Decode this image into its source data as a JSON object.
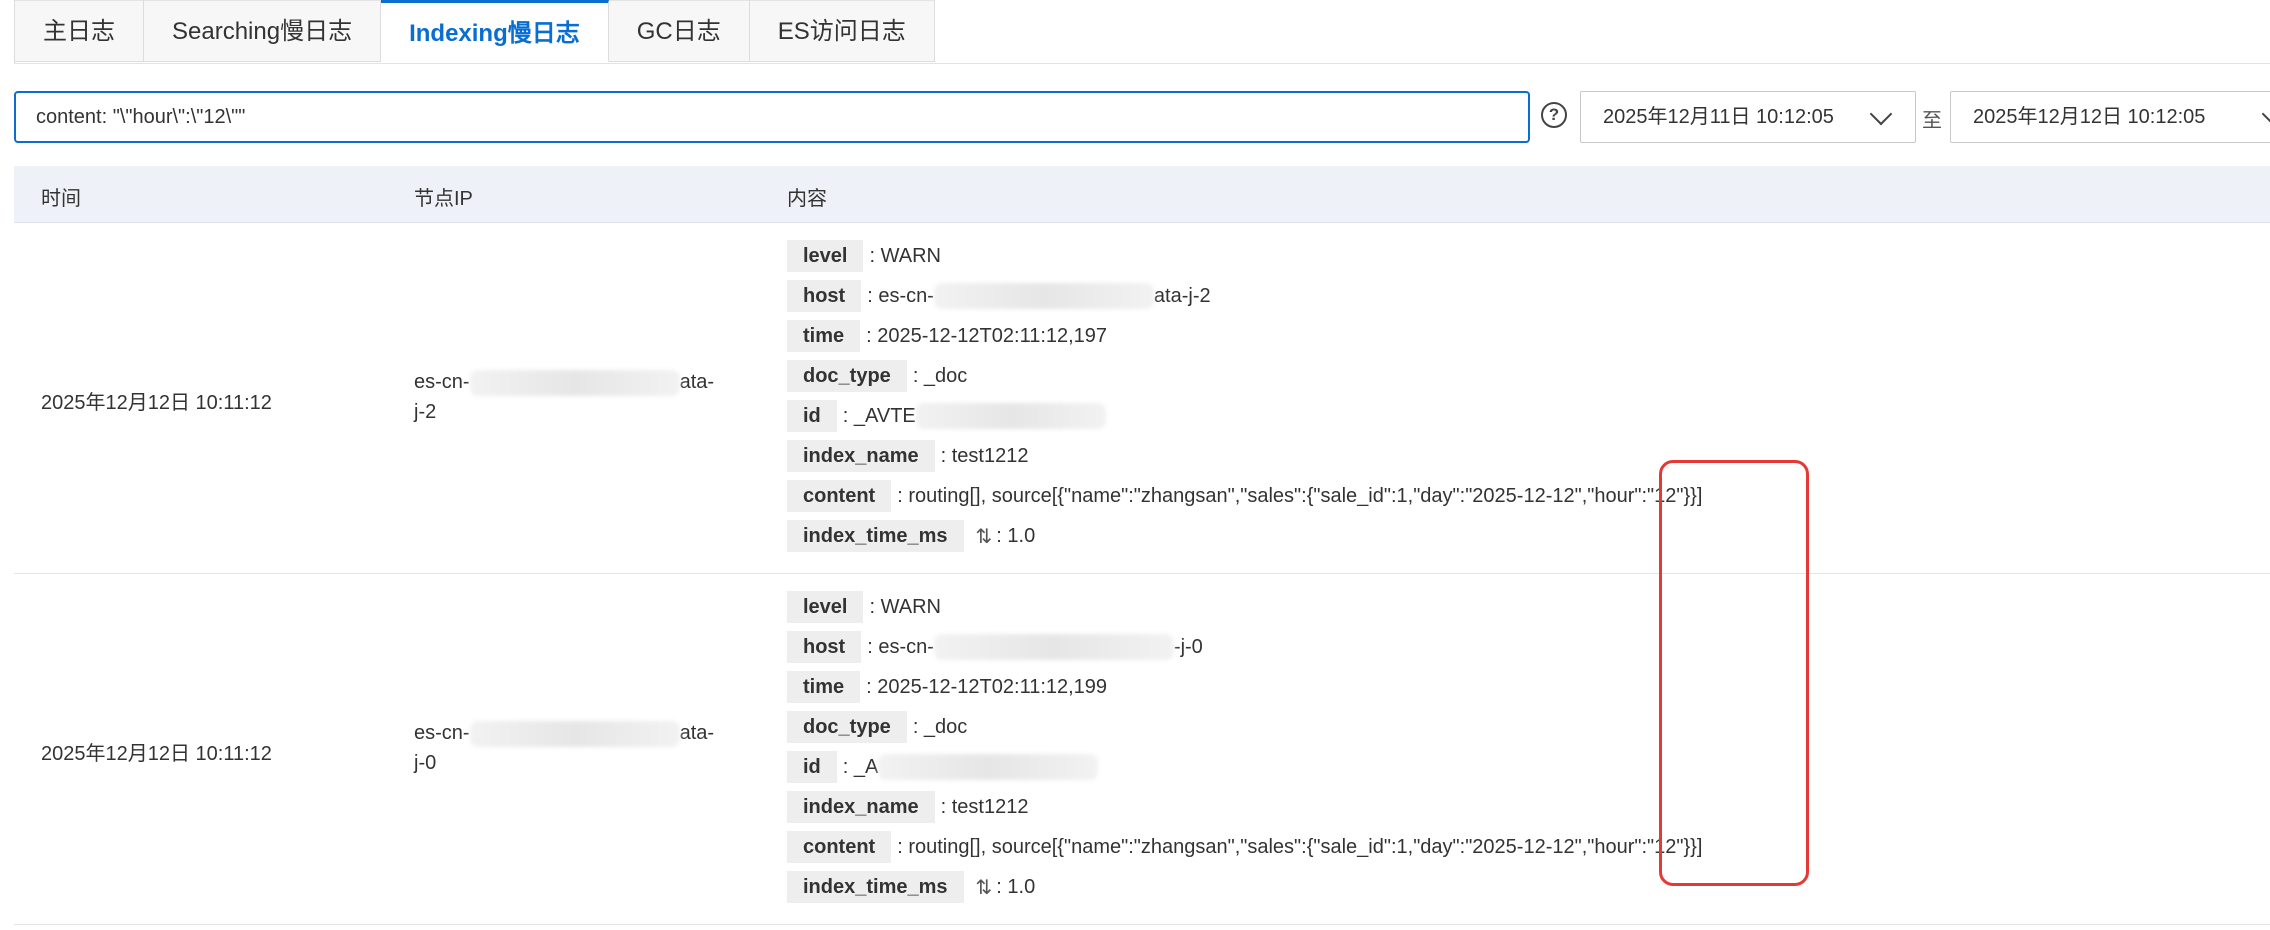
{
  "tabs": [
    {
      "label": "主日志",
      "active": false
    },
    {
      "label": "Searching慢日志",
      "active": false
    },
    {
      "label": "Indexing慢日志",
      "active": true
    },
    {
      "label": "GC日志",
      "active": false
    },
    {
      "label": "ES访问日志",
      "active": false
    }
  ],
  "search": {
    "value": "content: \"\\\"hour\\\":\\\"12\\\"\""
  },
  "help": {
    "symbol": "?"
  },
  "date_range": {
    "start": "2025年12月11日 10:12:05",
    "separator": "至",
    "end": "2025年12月12日 10:12:05"
  },
  "table": {
    "headers": {
      "time": "时间",
      "node_ip": "节点IP",
      "content": "内容"
    },
    "rows": [
      {
        "time": "2025年12月12日 10:11:12",
        "node_ip_prefix": "es-cn-",
        "node_ip_suffix": "ata-",
        "node_ip_line2": "j-2",
        "fields": {
          "level_key": "level",
          "level_val": ": WARN",
          "host_key": "host",
          "host_prefix": ": es-cn-",
          "host_suffix": "ata-j-2",
          "time_key": "time",
          "time_val": ": 2025-12-12T02:11:12,197",
          "doc_type_key": "doc_type",
          "doc_type_val": ": _doc",
          "id_key": "id",
          "id_val": ": _AVTE",
          "index_name_key": "index_name",
          "index_name_val": ": test1212",
          "content_key": "content",
          "content_val": ": routing[], source[{\"name\":\"zhangsan\",\"sales\":{\"sale_id\":1,\"day\":\"2025-12-12\",\"hour\":\"12\"}}]",
          "index_time_key": "index_time_ms",
          "index_time_val": ": 1.0"
        }
      },
      {
        "time": "2025年12月12日 10:11:12",
        "node_ip_prefix": "es-cn-",
        "node_ip_suffix": "ata-",
        "node_ip_line2": "j-0",
        "fields": {
          "level_key": "level",
          "level_val": ": WARN",
          "host_key": "host",
          "host_prefix": ": es-cn-",
          "host_suffix": "-j-0",
          "time_key": "time",
          "time_val": ": 2025-12-12T02:11:12,199",
          "doc_type_key": "doc_type",
          "doc_type_val": ": _doc",
          "id_key": "id",
          "id_val": ": _A",
          "index_name_key": "index_name",
          "index_name_val": ": test1212",
          "content_key": "content",
          "content_val": ": routing[], source[{\"name\":\"zhangsan\",\"sales\":{\"sale_id\":1,\"day\":\"2025-12-12\",\"hour\":\"12\"}}]",
          "index_time_key": "index_time_ms",
          "index_time_val": ": 1.0"
        }
      }
    ]
  },
  "sort_icon": {
    "symbol": "⇅"
  },
  "colors": {
    "accent": "#0a6ed1",
    "highlight": "#e53935",
    "header_bg": "#eef2f8",
    "key_bg": "#eeeeee"
  }
}
